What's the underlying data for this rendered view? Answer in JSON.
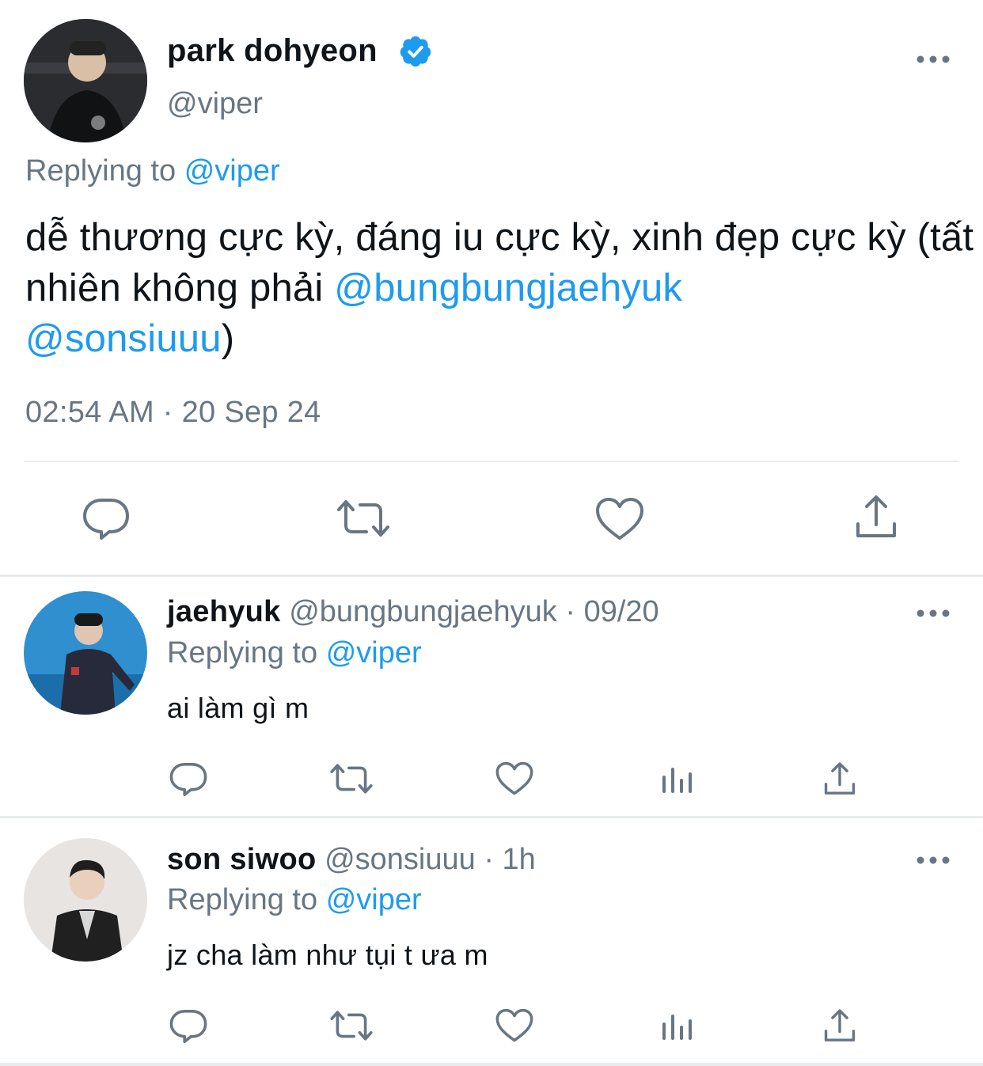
{
  "main_tweet": {
    "display_name": "park dohyeon",
    "handle": "@viper",
    "replying_prefix": "Replying to",
    "replying_to": "@viper",
    "text_before": "dễ thương cực kỳ, đáng iu cực kỳ, xinh đẹp cực kỳ (tất nhiên không phải ",
    "mention_1": "@bungbungjaehyuk",
    "mention_2": "@sonsiuuu",
    "text_after": ")",
    "timestamp": "02:54 AM · 20 Sep 24",
    "verified": true
  },
  "replies": [
    {
      "display_name": "jaehyuk",
      "handle": "@bungbungjaehyuk",
      "time": "· 09/20",
      "replying_prefix": "Replying to",
      "replying_to": "@viper",
      "text": "ai làm gì m"
    },
    {
      "display_name": "son siwoo",
      "handle": "@sonsiuuu",
      "time": "· 1h",
      "replying_prefix": "Replying to",
      "replying_to": "@viper",
      "text": "jz cha làm như tụi t ưa m"
    }
  ],
  "colors": {
    "accent": "#1d9bf0",
    "muted": "#687684",
    "text": "#0f1419",
    "divider": "#e8ecef"
  },
  "icons": {
    "more": "more-horizontal-icon",
    "reply": "reply-bubble-icon",
    "retweet": "retweet-icon",
    "like": "heart-icon",
    "views": "views-bar-chart-icon",
    "share": "share-upload-icon",
    "verified": "verified-badge-icon"
  }
}
